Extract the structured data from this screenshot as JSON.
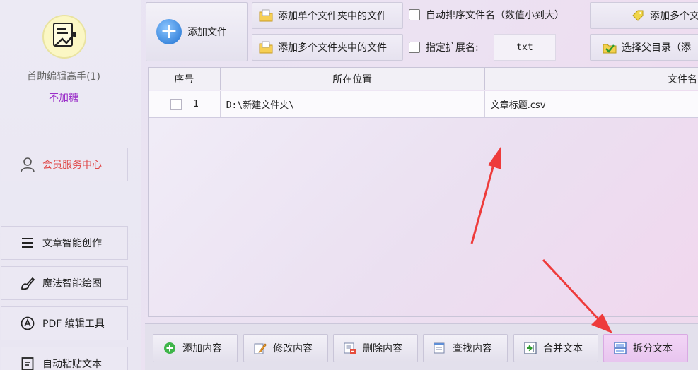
{
  "sidebar": {
    "app_title": "首助编辑高手(1)",
    "app_subtitle": "不加糖",
    "member_label": "会员服务中心",
    "items": [
      {
        "label": "文章智能创作"
      },
      {
        "label": "魔法智能绘图"
      },
      {
        "label": "PDF 编辑工具"
      },
      {
        "label": "自动粘贴文本"
      }
    ]
  },
  "toolbar": {
    "add_file": "添加文件",
    "add_single_folder": "添加单个文件夹中的文件",
    "add_multi_folder": "添加多个文件夹中的文件",
    "auto_sort": "自动排序文件名（数值小到大）",
    "specify_ext": "指定扩展名:",
    "ext_value": "txt",
    "add_multi_partial": "添加多个文",
    "choose_parent": "选择父目录（添"
  },
  "table": {
    "headers": [
      "序号",
      "所在位置",
      "文件名"
    ],
    "rows": [
      {
        "index": "1",
        "location": "D:\\新建文件夹\\",
        "filename": "文章标题.csv"
      }
    ]
  },
  "bottom": {
    "buttons": [
      {
        "label": "添加内容"
      },
      {
        "label": "修改内容"
      },
      {
        "label": "删除内容"
      },
      {
        "label": "查找内容"
      },
      {
        "label": "合并文本"
      },
      {
        "label": "拆分文本"
      }
    ]
  },
  "colors": {
    "accent_purple": "#9b2fc9",
    "member_red": "#e04848",
    "arrow_red": "#ee3b3b",
    "active_button": "#f3d6f6"
  }
}
